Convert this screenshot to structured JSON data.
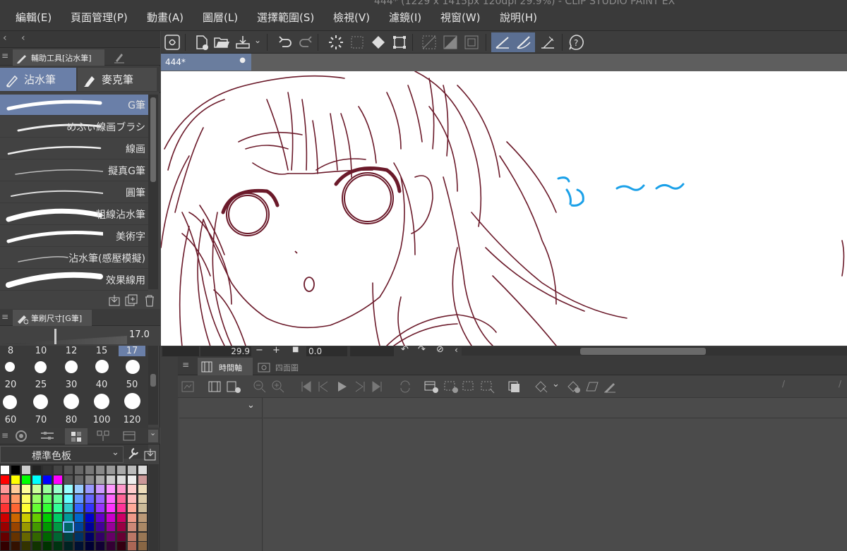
{
  "window": {
    "title_partial": "444* (1229 x 1415px 120dpi 29.9%) - CLIP STUDIO PAINT EX"
  },
  "menu": [
    {
      "label": "編輯(E)"
    },
    {
      "label": "頁面管理(P)"
    },
    {
      "label": "動畫(A)"
    },
    {
      "label": "圖層(L)"
    },
    {
      "label": "選擇範圍(S)"
    },
    {
      "label": "檢視(V)"
    },
    {
      "label": "濾鏡(I)"
    },
    {
      "label": "視窗(W)"
    },
    {
      "label": "說明(H)"
    }
  ],
  "subtool_panel": {
    "title": "輔助工具[沾水筆]",
    "tabs": [
      {
        "label": "沾水筆",
        "active": true
      },
      {
        "label": "麥克筆",
        "active": false
      }
    ],
    "brushes": [
      {
        "label": "G筆",
        "selected": true
      },
      {
        "label": "めふぃ線画ブラシ"
      },
      {
        "label": "線画"
      },
      {
        "label": "擬真G筆"
      },
      {
        "label": "圓筆"
      },
      {
        "label": "粗線沾水筆"
      },
      {
        "label": "美術字"
      },
      {
        "label": "沾水筆(感壓模擬)"
      },
      {
        "label": "效果線用"
      }
    ]
  },
  "brush_size_panel": {
    "title": "筆刷尺寸[G筆]",
    "value": "17.0",
    "presets_row1": [
      "8",
      "10",
      "12",
      "15",
      "17"
    ],
    "presets_row2": [
      "20",
      "25",
      "30",
      "40",
      "50"
    ],
    "presets_row3": [
      "60",
      "70",
      "80",
      "100",
      "120"
    ],
    "selected": "17"
  },
  "color_panel": {
    "set_name": "標準色板"
  },
  "document": {
    "tab_label": "444*",
    "zoom": "29.9",
    "rotation": "0.0"
  },
  "timeline": {
    "tab1": "時間軸",
    "tab2": "四面圖"
  },
  "colors": {
    "menubar_bg": "#3a3a3a",
    "panel_bg": "#424242",
    "selection_blue": "#6a7fa8",
    "line_art": "#6b1a2a",
    "accent_cyan": "#1aa0e8"
  }
}
